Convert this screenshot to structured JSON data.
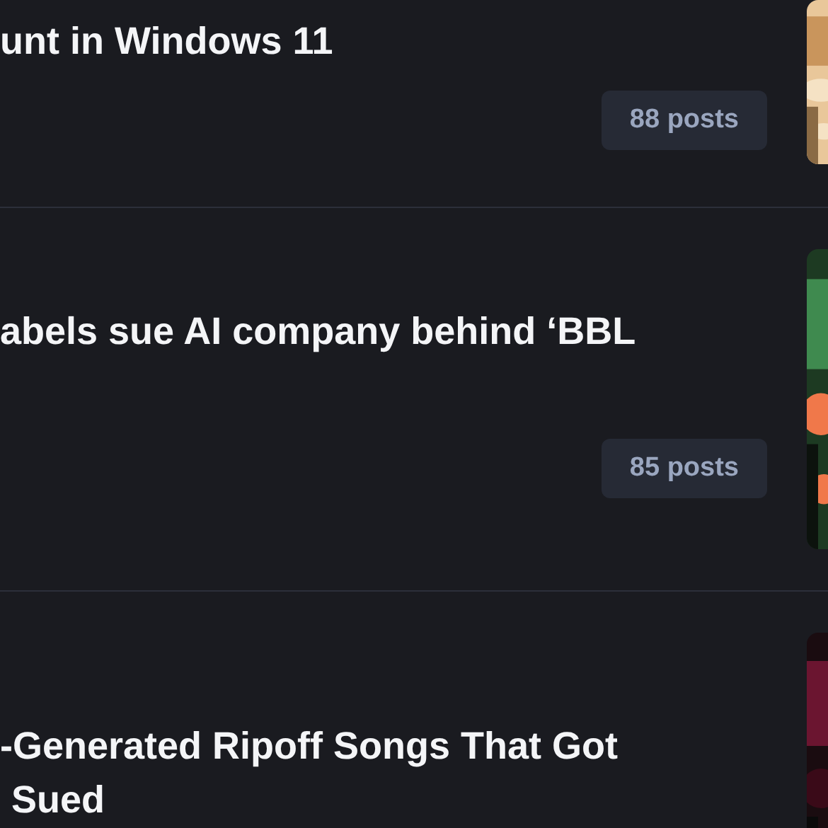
{
  "stories": [
    {
      "title_lines": [
        "unt in Windows 11"
      ],
      "posts": "88 posts",
      "thumbnail": {
        "kind": "picture"
      }
    },
    {
      "title_lines": [
        "abels sue AI company behind ‘BBL"
      ],
      "posts": "85 posts",
      "thumbnail": {
        "kind": "picture"
      }
    },
    {
      "title_lines": [
        "-Generated Ripoff Songs That Got",
        "Sued"
      ],
      "thumbnail": {
        "kind": "picture"
      }
    }
  ]
}
